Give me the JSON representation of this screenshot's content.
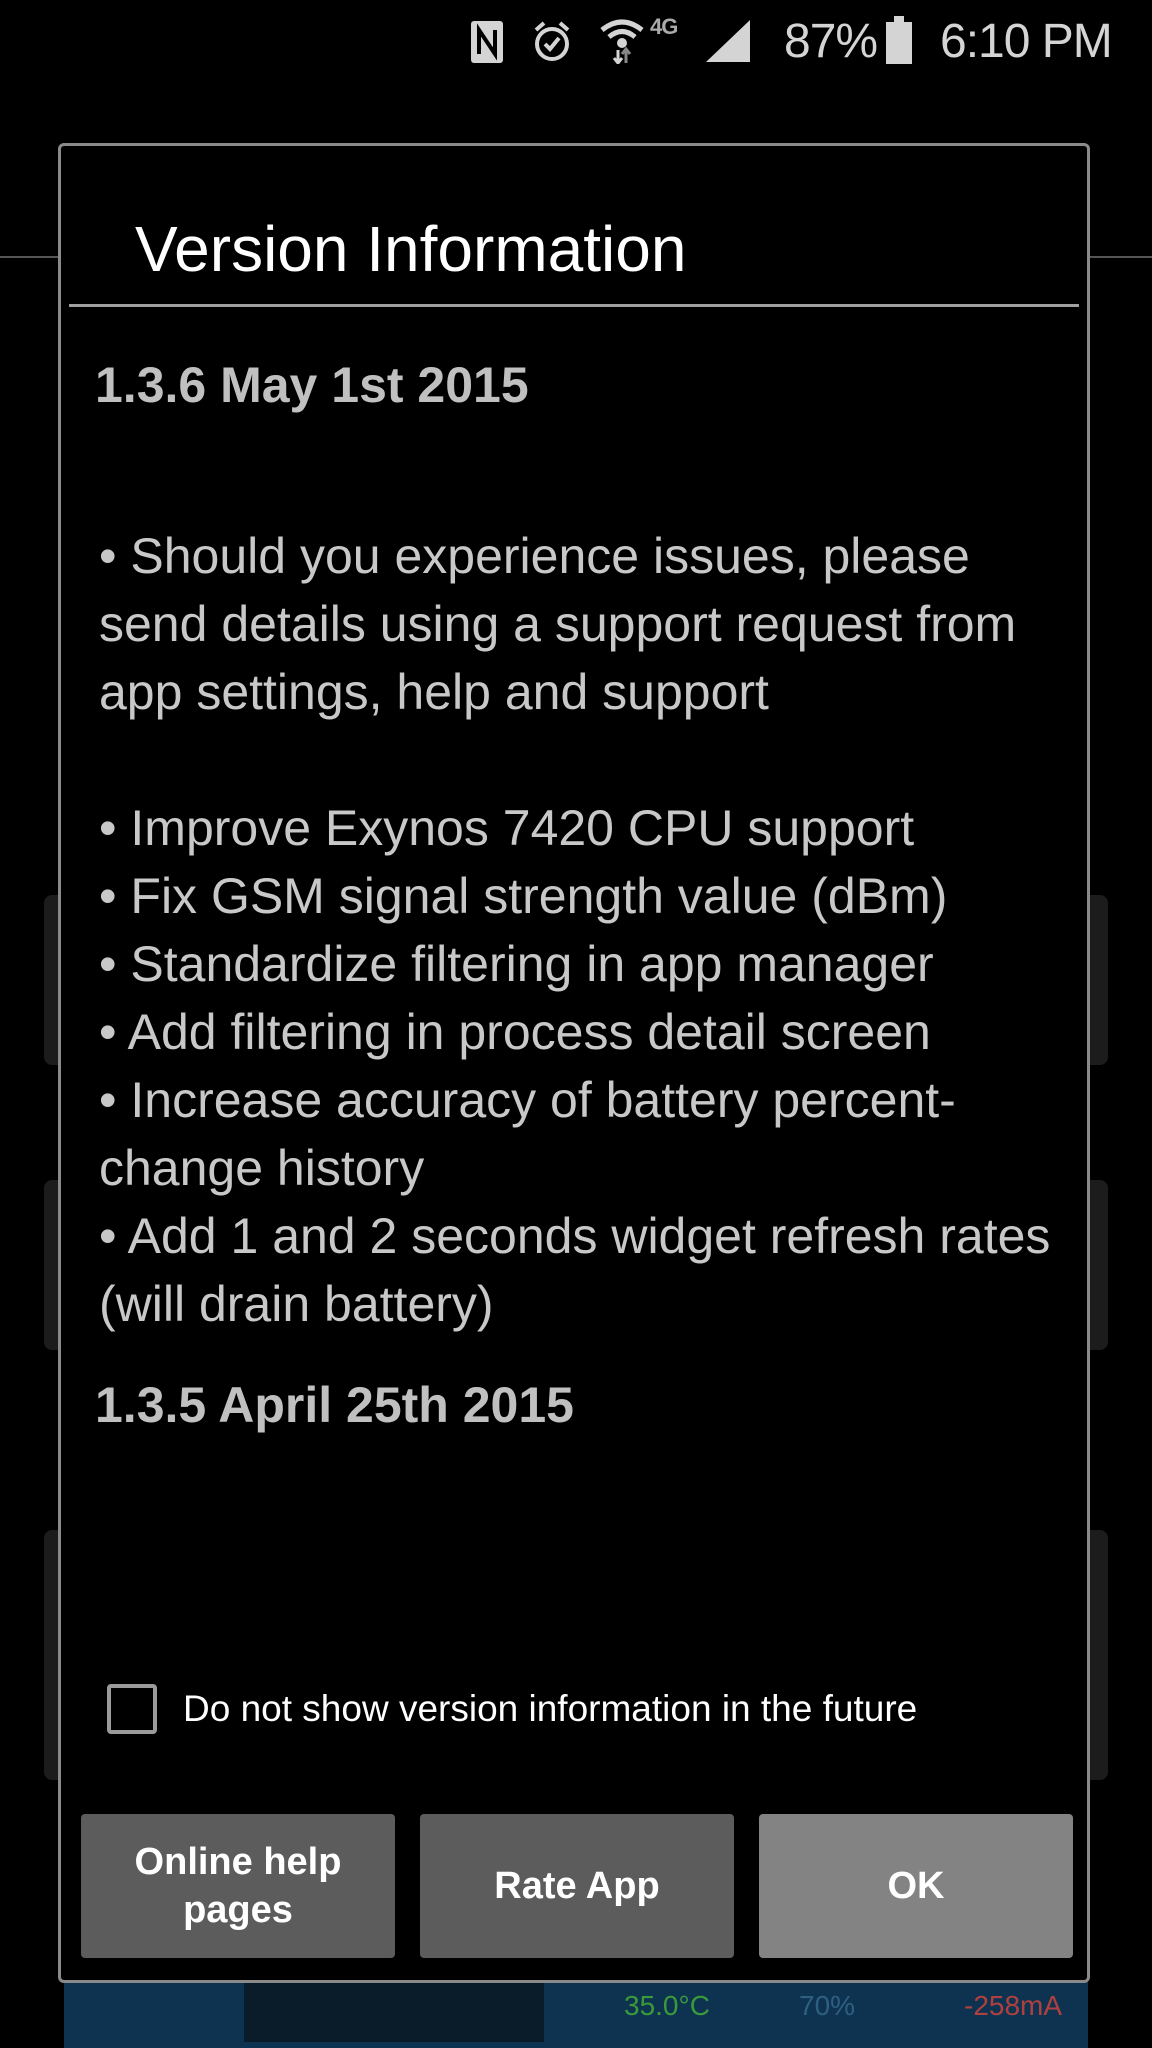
{
  "status_bar": {
    "icons": [
      "nfc-icon",
      "alarm-icon",
      "wifi-icon",
      "4g-lte-icon",
      "signal-icon",
      "battery-icon"
    ],
    "network_type": "4G",
    "battery_percent": "87%",
    "time": "6:10 PM"
  },
  "dialog": {
    "title": "Version Information",
    "versions": [
      {
        "heading": "1.3.6  May 1st 2015",
        "notes": [
          "• Should you experience issues, please send details using a support request from app settings, help and support",
          "• Improve Exynos 7420 CPU support",
          "• Fix GSM signal strength value (dBm)",
          "• Standardize filtering in app manager",
          "• Add filtering in process detail screen",
          "• Increase accuracy of battery percent-change history",
          "• Add 1 and 2 seconds widget refresh rates (will drain battery)"
        ]
      },
      {
        "heading": "1.3.5  April 25th 2015",
        "notes": []
      }
    ],
    "checkbox": {
      "label": "Do not show version information in the future",
      "checked": false
    },
    "buttons": {
      "help": "Online help pages",
      "rate": "Rate App",
      "ok": "OK"
    }
  },
  "background_widget": {
    "temperature": "35.0°C",
    "battery_level": "70%",
    "current": "-258mA"
  },
  "colors": {
    "button_dark": "#5c5c5c",
    "button_ok": "#838383",
    "temperature_text": "#3a9a3a",
    "current_text": "#b04040"
  }
}
